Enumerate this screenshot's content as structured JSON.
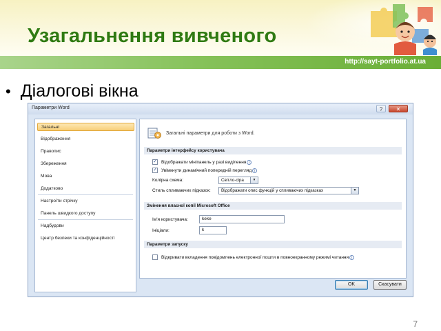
{
  "slide": {
    "title": "Узагальнення вивченого",
    "url": "http://sayt-portfolio.at.ua",
    "bullet": "Діалогові вікна",
    "number": "7"
  },
  "dialog": {
    "title": "Параметри Word",
    "help_label": "?",
    "close_label": "✕",
    "nav": [
      {
        "label": "Загальні",
        "selected": true
      },
      {
        "label": "Відображення"
      },
      {
        "label": "Правопис"
      },
      {
        "label": "Збереження"
      },
      {
        "label": "Мова"
      },
      {
        "label": "Додатково"
      },
      {
        "label": "Настроїти стрічку"
      },
      {
        "label": "Панель швидкого доступу"
      },
      {
        "label": "Надбудови"
      },
      {
        "label": "Центр безпеки та конфіденційності"
      }
    ],
    "main": {
      "heading": "Загальні параметри для роботи з Word.",
      "ui_section": {
        "title": "Параметри інтерфейсу користувача",
        "options": [
          {
            "label": "Відображати мініпанель у разі виділення",
            "checked": true
          },
          {
            "label": "Увімкнути динамічний попередній перегляд",
            "checked": true
          }
        ],
        "color_scheme_label": "Колірна схема:",
        "color_scheme_value": "Світло-сіра",
        "tooltip_style_label": "Стиль спливаючих підказок:",
        "tooltip_style_value": "Відображати опис функцій у спливаючих підказках"
      },
      "personalize_section": {
        "title": "Змінення власної копії Microsoft Office",
        "username_label": "Ім'я користувача:",
        "username_value": "keke",
        "initials_label": "Ініціали:",
        "initials_value": "k"
      },
      "startup_section": {
        "title": "Параметри запуску",
        "option_label": "Відкривати вкладення повідомлень електронної пошти в повноекранному режимі читання",
        "option_checked": false
      }
    },
    "ok_label": "OK",
    "cancel_label": "Скасувати"
  },
  "colors": {
    "title_green": "#2f7a12",
    "url_bar_green": "#86c25a",
    "selected_nav": "#f8cf78"
  }
}
